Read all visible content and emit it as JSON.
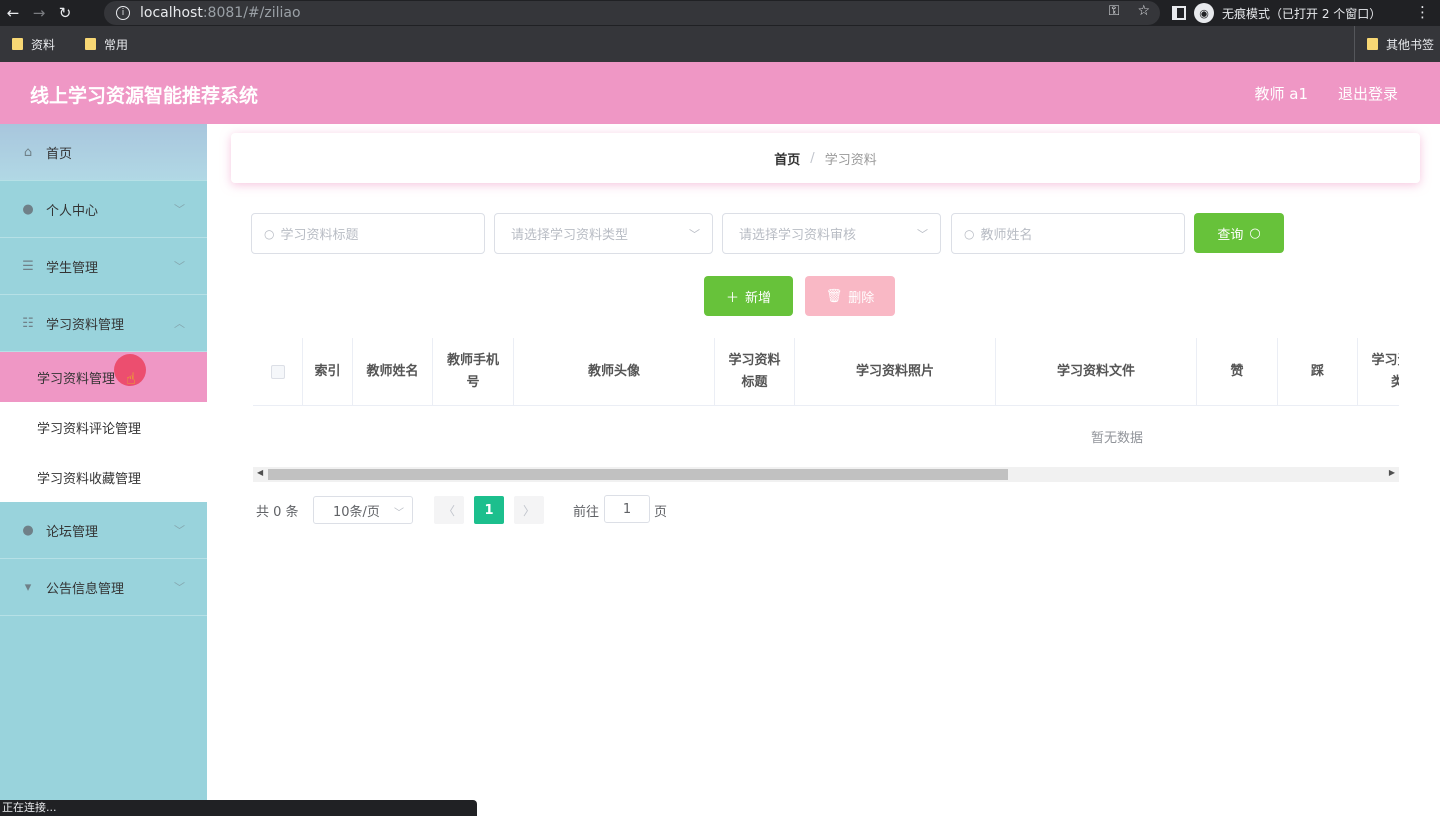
{
  "browser": {
    "url_host": "localhost",
    "url_rest": ":8081/#/ziliao",
    "incognito_label": "无痕模式（已打开 2 个窗口）",
    "bookmarks": [
      "资料",
      "常用"
    ],
    "other_bookmarks": "其他书签",
    "status_text": "正在连接..."
  },
  "header": {
    "title": "线上学习资源智能推荐系统",
    "user": "教师 a1",
    "logout": "退出登录",
    "color": "#ef97c5"
  },
  "sidebar": {
    "items": [
      {
        "label": "首页",
        "icon": "home-icon"
      },
      {
        "label": "个人中心",
        "icon": "user-icon"
      },
      {
        "label": "学生管理",
        "icon": "list-icon"
      },
      {
        "label": "学习资料管理",
        "icon": "sliders-icon"
      },
      {
        "label": "论坛管理",
        "icon": "bulb-icon"
      },
      {
        "label": "公告信息管理",
        "icon": "notice-icon"
      }
    ],
    "sub_items": [
      "学习资料管理",
      "学习资料评论管理",
      "学习资料收藏管理"
    ]
  },
  "breadcrumb": {
    "home": "首页",
    "sep": "/",
    "current": "学习资料"
  },
  "search": {
    "title_placeholder": "学习资料标题",
    "type_placeholder": "请选择学习资料类型",
    "audit_placeholder": "请选择学习资料审核",
    "teacher_placeholder": "教师姓名",
    "query_label": "查询"
  },
  "actions": {
    "add_label": "新增",
    "delete_label": "删除"
  },
  "table": {
    "columns": [
      "索引",
      "教师姓名",
      "教师手机号",
      "教师头像",
      "学习资料标题",
      "学习资料照片",
      "学习资料文件",
      "赞",
      "踩",
      "学习资料类"
    ],
    "empty_text": "暂无数据"
  },
  "pagination": {
    "total": "共 0 条",
    "page_size": "10条/页",
    "current_page": "1",
    "goto_label": "前往",
    "goto_value": "1",
    "page_unit": "页"
  }
}
